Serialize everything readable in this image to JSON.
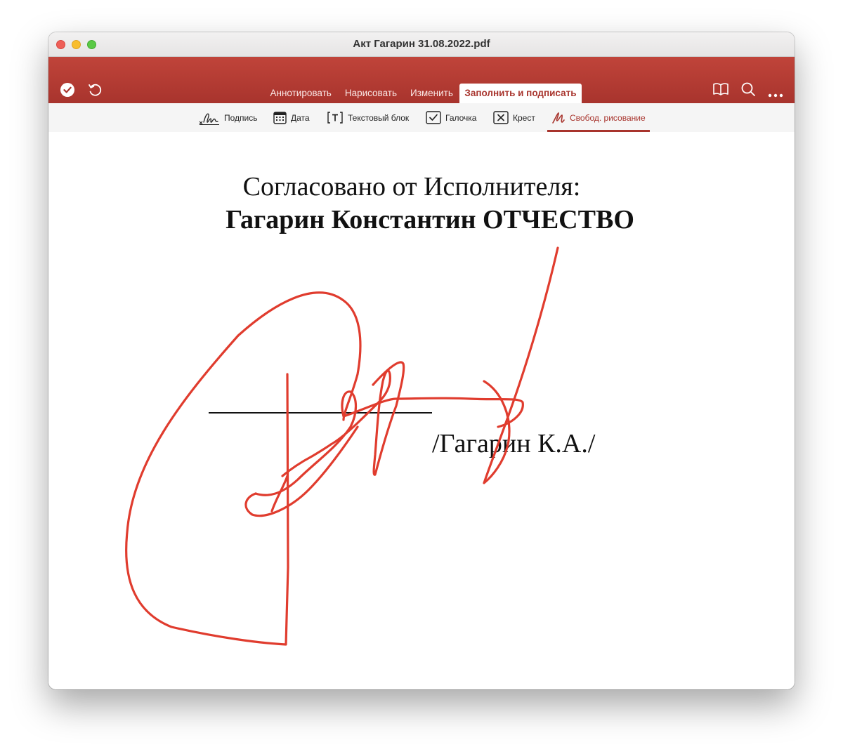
{
  "window": {
    "title": "Акт Гагарин 31.08.2022.pdf"
  },
  "ribbon": {
    "tabs": [
      {
        "label": "Аннотировать"
      },
      {
        "label": "Нарисовать"
      },
      {
        "label": "Изменить"
      },
      {
        "label": "Заполнить и подписать",
        "active": true
      }
    ],
    "left_icons": [
      "done-checkmark-icon",
      "undo-icon"
    ],
    "right_icons": [
      "book-icon",
      "search-icon",
      "more-icon"
    ]
  },
  "toolbar": {
    "tools": [
      {
        "label": "Подпись",
        "icon": "signature-icon"
      },
      {
        "label": "Дата",
        "icon": "calendar-icon"
      },
      {
        "label": "Текстовый блок",
        "icon": "text-box-icon"
      },
      {
        "label": "Галочка",
        "icon": "checkmark-box-icon"
      },
      {
        "label": "Крест",
        "icon": "cross-box-icon"
      },
      {
        "label": "Свобод. рисование",
        "icon": "freehand-icon",
        "active": true
      }
    ]
  },
  "document": {
    "heading_line1": "Согласовано от Исполнителя:",
    "heading_line2": "Гагарин Константин ОТЧЕСТВО",
    "signature_name": "/Гагарин К.А./"
  },
  "colors": {
    "accent": "#a8342d",
    "ink": "#e03c2e"
  },
  "fab": {
    "icon": "more-icon"
  }
}
